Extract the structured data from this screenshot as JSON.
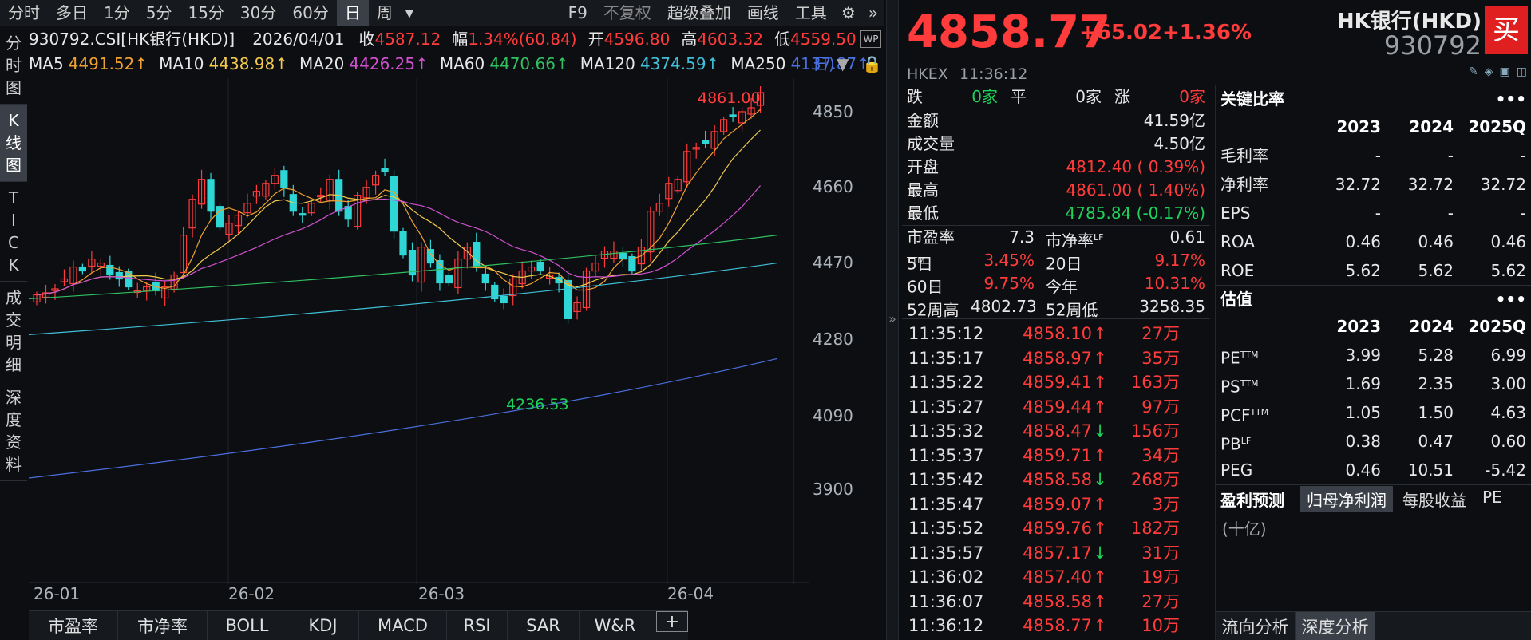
{
  "toolbar": {
    "periods": [
      "分时",
      "多日",
      "1分",
      "5分",
      "15分",
      "30分",
      "60分",
      "日",
      "周"
    ],
    "selected": "日",
    "right": [
      "F9",
      "不复权",
      "超级叠加",
      "画线",
      "工具"
    ]
  },
  "side_tabs": [
    {
      "label": "分\n时\n图",
      "sel": false
    },
    {
      "label": "K\n线\n图",
      "sel": true
    },
    {
      "label": "T\nI\nC\nK",
      "sel": false
    },
    {
      "label": "成\n交\n明\n细",
      "sel": false
    },
    {
      "label": "深\n度\n资\n料",
      "sel": false
    }
  ],
  "info": {
    "code": "930792.CSI[HK银行(HKD)]",
    "date": "2026/04/01",
    "close_label": "收",
    "close": "4587.12",
    "amp_label": "幅",
    "amp": "1.34%(60.84)",
    "open_label": "开",
    "open": "4596.80",
    "high_label": "高",
    "high": "4603.32",
    "low_label": "低",
    "low": "4559.50"
  },
  "ma": [
    {
      "label": "MA5",
      "value": "4491.52↑",
      "color": "#f0a030"
    },
    {
      "label": "MA10",
      "value": "4438.98↑",
      "color": "#f2c94c"
    },
    {
      "label": "MA20",
      "value": "4426.25↑",
      "color": "#d050d0"
    },
    {
      "label": "MA60",
      "value": "4470.66↑",
      "color": "#30c060"
    },
    {
      "label": "MA120",
      "value": "4374.59↑",
      "color": "#40c0d8"
    },
    {
      "label": "MA250",
      "value": "4137.87↑",
      "color": "#4a70e0"
    }
  ],
  "ma_tail": "日)",
  "chart_data": {
    "type": "candlestick",
    "y_ticks": [
      "4850",
      "4660",
      "4470",
      "4280",
      "4090",
      "3900"
    ],
    "x_ticks": [
      "26-01",
      "26-02",
      "26-03",
      "26-04"
    ],
    "max_label": "4861.00",
    "min_label": "4236.53"
  },
  "bottom_tabs": [
    "市盈率",
    "市净率",
    "BOLL",
    "KDJ",
    "MACD",
    "RSI",
    "SAR",
    "W&R"
  ],
  "quote": {
    "price": "4858.77",
    "change": "+65.02",
    "pct": "+1.36%",
    "name": "HK银行(HKD)",
    "code": "930792",
    "buy": "买",
    "exchange": "HKEX",
    "time": "11:36:12"
  },
  "breadth": {
    "down_label": "跌",
    "down": "0家",
    "flat_label": "平",
    "flat": "0家",
    "up_label": "涨",
    "up": "0家"
  },
  "stats": [
    {
      "k": "金额",
      "v": "41.59亿",
      "c": "white"
    },
    {
      "k": "成交量",
      "v": "4.50亿",
      "c": "white"
    },
    {
      "k": "开盘",
      "v": "4812.40 ( 0.39%)",
      "c": "red"
    },
    {
      "k": "最高",
      "v": "4861.00 ( 1.40%)",
      "c": "red"
    },
    {
      "k": "最低",
      "v": "4785.84 (-0.17%)",
      "c": "green"
    }
  ],
  "pair_stats": [
    {
      "k1": "市盈率",
      "s1": "TTM",
      "v1": "7.3",
      "c1": "white",
      "k2": "市净率",
      "s2": "LF",
      "v2": "0.61",
      "c2": "white"
    },
    {
      "k1": "5日",
      "s1": "",
      "v1": "3.45%",
      "c1": "red",
      "k2": "20日",
      "s2": "",
      "v2": "9.17%",
      "c2": "red"
    },
    {
      "k1": "60日",
      "s1": "",
      "v1": "9.75%",
      "c1": "red",
      "k2": "今年",
      "s2": "",
      "v2": "10.31%",
      "c2": "red"
    },
    {
      "k1": "52周高",
      "s1": "",
      "v1": "4802.73",
      "c1": "white",
      "k2": "52周低",
      "s2": "",
      "v2": "3258.35",
      "c2": "white"
    }
  ],
  "ticks": [
    {
      "t": "11:35:12",
      "p": "4858.10",
      "d": "up",
      "v": "27万"
    },
    {
      "t": "11:35:17",
      "p": "4858.97",
      "d": "up",
      "v": "35万"
    },
    {
      "t": "11:35:22",
      "p": "4859.41",
      "d": "up",
      "v": "163万"
    },
    {
      "t": "11:35:27",
      "p": "4859.44",
      "d": "up",
      "v": "97万"
    },
    {
      "t": "11:35:32",
      "p": "4858.47",
      "d": "down",
      "v": "156万"
    },
    {
      "t": "11:35:37",
      "p": "4859.71",
      "d": "up",
      "v": "34万"
    },
    {
      "t": "11:35:42",
      "p": "4858.58",
      "d": "down",
      "v": "268万"
    },
    {
      "t": "11:35:47",
      "p": "4859.07",
      "d": "up",
      "v": "3万"
    },
    {
      "t": "11:35:52",
      "p": "4859.76",
      "d": "up",
      "v": "182万"
    },
    {
      "t": "11:35:57",
      "p": "4857.17",
      "d": "down",
      "v": "31万"
    },
    {
      "t": "11:36:02",
      "p": "4857.40",
      "d": "up",
      "v": "19万"
    },
    {
      "t": "11:36:07",
      "p": "4858.58",
      "d": "up",
      "v": "27万"
    },
    {
      "t": "11:36:12",
      "p": "4858.77",
      "d": "up",
      "v": "10万"
    }
  ],
  "key_ratios": {
    "title": "关键比率",
    "cols": [
      "2023",
      "2024",
      "2025Q"
    ],
    "rows": [
      {
        "k": "毛利率",
        "v": [
          "-",
          "-",
          "-"
        ]
      },
      {
        "k": "净利率",
        "v": [
          "32.72",
          "32.72",
          "32.72"
        ]
      },
      {
        "k": "EPS",
        "v": [
          "-",
          "-",
          "-"
        ]
      },
      {
        "k": "ROA",
        "v": [
          "0.46",
          "0.46",
          "0.46"
        ]
      },
      {
        "k": "ROE",
        "v": [
          "5.62",
          "5.62",
          "5.62"
        ]
      }
    ]
  },
  "valuation": {
    "title": "估值",
    "cols": [
      "2023",
      "2024",
      "2025Q"
    ],
    "rows": [
      {
        "k": "PE",
        "s": "TTM",
        "v": [
          "3.99",
          "5.28",
          "6.99"
        ]
      },
      {
        "k": "PS",
        "s": "TTM",
        "v": [
          "1.69",
          "2.35",
          "3.00"
        ]
      },
      {
        "k": "PCF",
        "s": "TTM",
        "v": [
          "1.05",
          "1.50",
          "4.63"
        ]
      },
      {
        "k": "PB",
        "s": "LF",
        "v": [
          "0.38",
          "0.47",
          "0.60"
        ]
      },
      {
        "k": "PEG",
        "s": "",
        "v": [
          "0.46",
          "10.51",
          "-5.42"
        ]
      }
    ]
  },
  "forecast": {
    "title": "盈利预测",
    "tabs": [
      "归母净利润",
      "每股收益",
      "PE"
    ],
    "unit": "(十亿)"
  },
  "bottom_right_tabs": [
    "流向分析",
    "深度分析"
  ]
}
